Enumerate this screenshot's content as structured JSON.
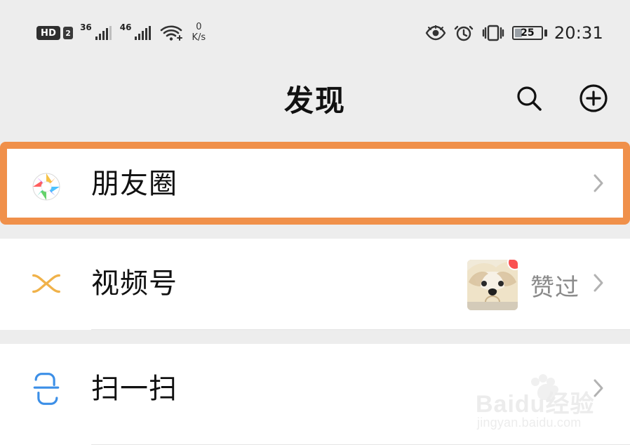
{
  "status_bar": {
    "hd": "HD",
    "sim": "2",
    "net_3g": "36",
    "net_4g": "46",
    "speed_value": "0",
    "speed_unit": "K/s",
    "battery_percent": "25",
    "time": "20:31",
    "icons": {
      "eye": "eye-icon",
      "alarm": "alarm-icon",
      "vibrate": "vibrate-icon",
      "wifi": "wifi-icon",
      "signal": "signal-icon",
      "battery": "battery-icon"
    }
  },
  "header": {
    "title": "发现",
    "search_icon": "search-icon",
    "add_icon": "add-circle-icon"
  },
  "list": {
    "items": [
      {
        "key": "moments",
        "label": "朋友圈",
        "icon": "moments-icon",
        "highlighted": true,
        "highlight_color": "#f0904a"
      },
      {
        "key": "channels",
        "label": "视频号",
        "icon": "channels-icon",
        "meta_text": "赞过",
        "has_avatar": true,
        "badge_color": "#fa5151"
      },
      {
        "key": "scan",
        "label": "扫一扫",
        "icon": "scan-icon"
      }
    ]
  },
  "watermark": {
    "brand": "Baidu经验",
    "domain": "jingyan.baidu.com",
    "icon": "paw-icon"
  },
  "colors": {
    "background": "#ededed",
    "row_bg": "#ffffff",
    "highlight": "#f0904a",
    "badge": "#fa5151",
    "chevron": "#b2b2b2",
    "meta_text": "#8a8a8a"
  }
}
